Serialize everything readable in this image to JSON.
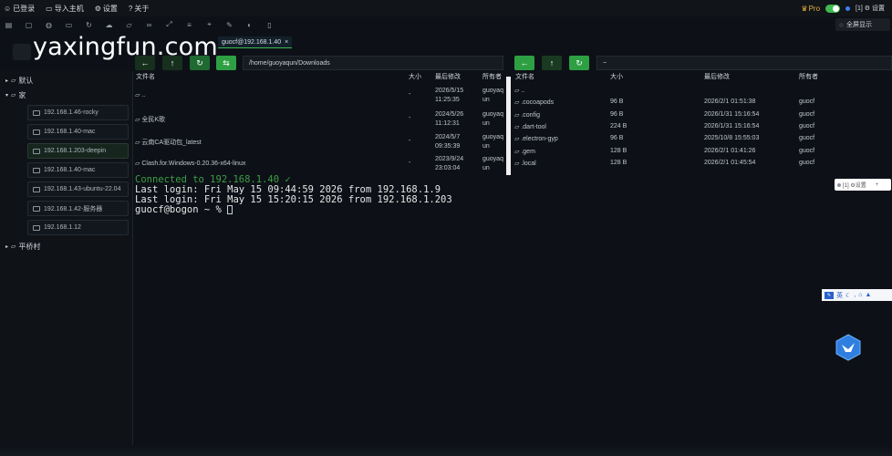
{
  "topbar": {
    "menu": [
      {
        "icon": "user-icon",
        "label": "已登录"
      },
      {
        "icon": "import-icon",
        "label": "导入主机"
      },
      {
        "icon": "gear-icon",
        "label": "设置"
      },
      {
        "icon": "help-icon",
        "label": "关于"
      }
    ],
    "pro_label": "Pro",
    "session_label": "[1] ⚙ 设置",
    "popup_label": "全屏显示"
  },
  "watermark": "yaxingfun.com",
  "tab": {
    "label": "guocf@192.168.1.40",
    "close": "×"
  },
  "sidebar": {
    "groups": [
      {
        "label": "默认",
        "expanded": false
      },
      {
        "label": "家",
        "expanded": true
      }
    ],
    "hosts": [
      {
        "label": "192.168.1.46-rocky"
      },
      {
        "label": "192.168.1.40-mac"
      },
      {
        "label": "192.168.1.203-deepin"
      },
      {
        "label": "192.168.1.40-mac"
      },
      {
        "label": "192.168.1.43-ubuntu-22.04"
      },
      {
        "label": "192.168.1.42-服务器"
      },
      {
        "label": "192.168.1.12"
      }
    ],
    "last_group": {
      "label": "平桥村",
      "expanded": false
    }
  },
  "left_pane": {
    "path": "/home/guoyaqun/Downloads",
    "headers": [
      "文件名",
      "大小",
      "最后修改",
      "所有者"
    ],
    "rows": [
      {
        "name": "..",
        "size": "-",
        "modified": "2026/5/15 11:25:35",
        "owner": "guoyaq un"
      },
      {
        "name": "全民K歌",
        "size": "-",
        "modified": "2024/5/26 11:12:31",
        "owner": "guoyaq un"
      },
      {
        "name": "云南CA驱动包_latest",
        "size": "-",
        "modified": "2024/5/7 09:35:39",
        "owner": "guoyaq un"
      },
      {
        "name": "Clash.for.Windows-0.20.36-x64-linux",
        "size": "-",
        "modified": "2023/9/24 23:03:04",
        "owner": "guoyaq un"
      }
    ]
  },
  "right_pane": {
    "path": "~",
    "headers": [
      "文件名",
      "大小",
      "最后修改",
      "所有者"
    ],
    "rows": [
      {
        "name": "..",
        "size": "",
        "modified": "",
        "owner": ""
      },
      {
        "name": ".cocoapods",
        "size": "96 B",
        "modified": "2026/2/1 01:51:38",
        "owner": "guocf"
      },
      {
        "name": ".config",
        "size": "96 B",
        "modified": "2026/1/31 15:16:54",
        "owner": "guocf"
      },
      {
        "name": ".dart-tool",
        "size": "224 B",
        "modified": "2026/1/31 15:16:54",
        "owner": "guocf"
      },
      {
        "name": ".electron-gyp",
        "size": "96 B",
        "modified": "2025/10/8 15:55:03",
        "owner": "guocf"
      },
      {
        "name": ".gem",
        "size": "128 B",
        "modified": "2026/2/1 01:41:26",
        "owner": "guocf"
      },
      {
        "name": ".local",
        "size": "128 B",
        "modified": "2026/2/1 01:45:54",
        "owner": "guocf"
      }
    ]
  },
  "terminal": {
    "connected": "Connected to 192.168.1.40 ✓",
    "lines": [
      "Last login: Fri May 15 09:44:59 2026 from 192.168.1.9",
      "Last login: Fri May 15 15:20:15 2026 from 192.168.1.203"
    ],
    "prompt": "guocf@bogon ~ % "
  },
  "floater": {
    "label": "[1] ⚙设置",
    "plus": "+"
  },
  "ime": {
    "lang": "英"
  },
  "colors": {
    "accent_green": "#3fb950",
    "terminal_green": "#3c9e45",
    "background": "#0d1117"
  }
}
